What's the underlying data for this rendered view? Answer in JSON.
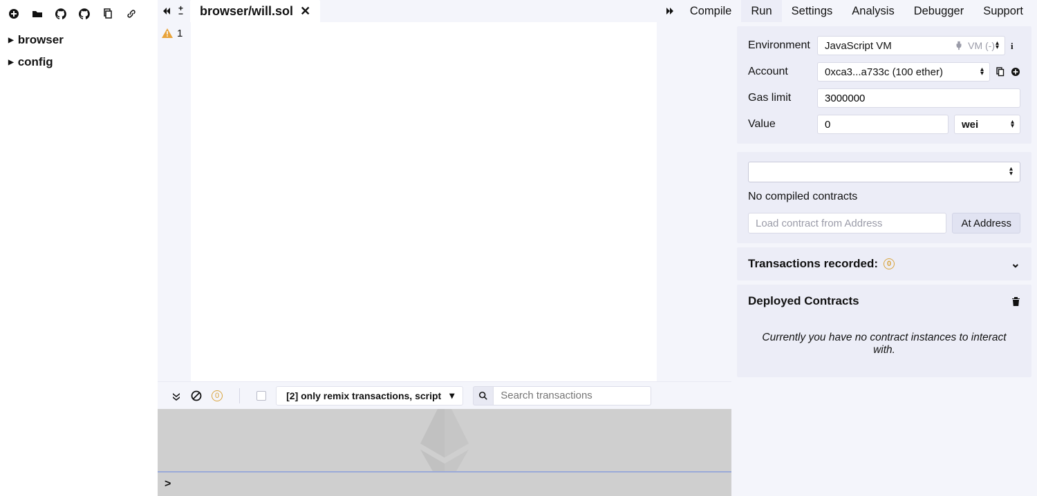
{
  "file_panel": {
    "tree": [
      "browser",
      "config"
    ]
  },
  "editor": {
    "active_tab": "browser/will.sol",
    "warning_count": "1"
  },
  "right_tabs": {
    "compile": "Compile",
    "run": "Run",
    "settings": "Settings",
    "analysis": "Analysis",
    "debugger": "Debugger",
    "support": "Support",
    "active": "Run"
  },
  "run": {
    "env_label": "Environment",
    "env_value": "JavaScript VM",
    "env_note": "VM (-)",
    "account_label": "Account",
    "account_value": "0xca3...a733c (100 ether)",
    "gas_label": "Gas limit",
    "gas_value": "3000000",
    "value_label": "Value",
    "value_amount": "0",
    "value_unit": "wei",
    "no_compiled": "No compiled contracts",
    "load_placeholder": "Load contract from Address",
    "at_address": "At Address"
  },
  "tx": {
    "title": "Transactions recorded:",
    "count": "0"
  },
  "deployed": {
    "title": "Deployed Contracts",
    "empty": "Currently you have no contract instances to interact with."
  },
  "terminal": {
    "pending": "0",
    "filter": "[2] only remix transactions, script",
    "search_placeholder": "Search transactions",
    "prompt": ">"
  }
}
